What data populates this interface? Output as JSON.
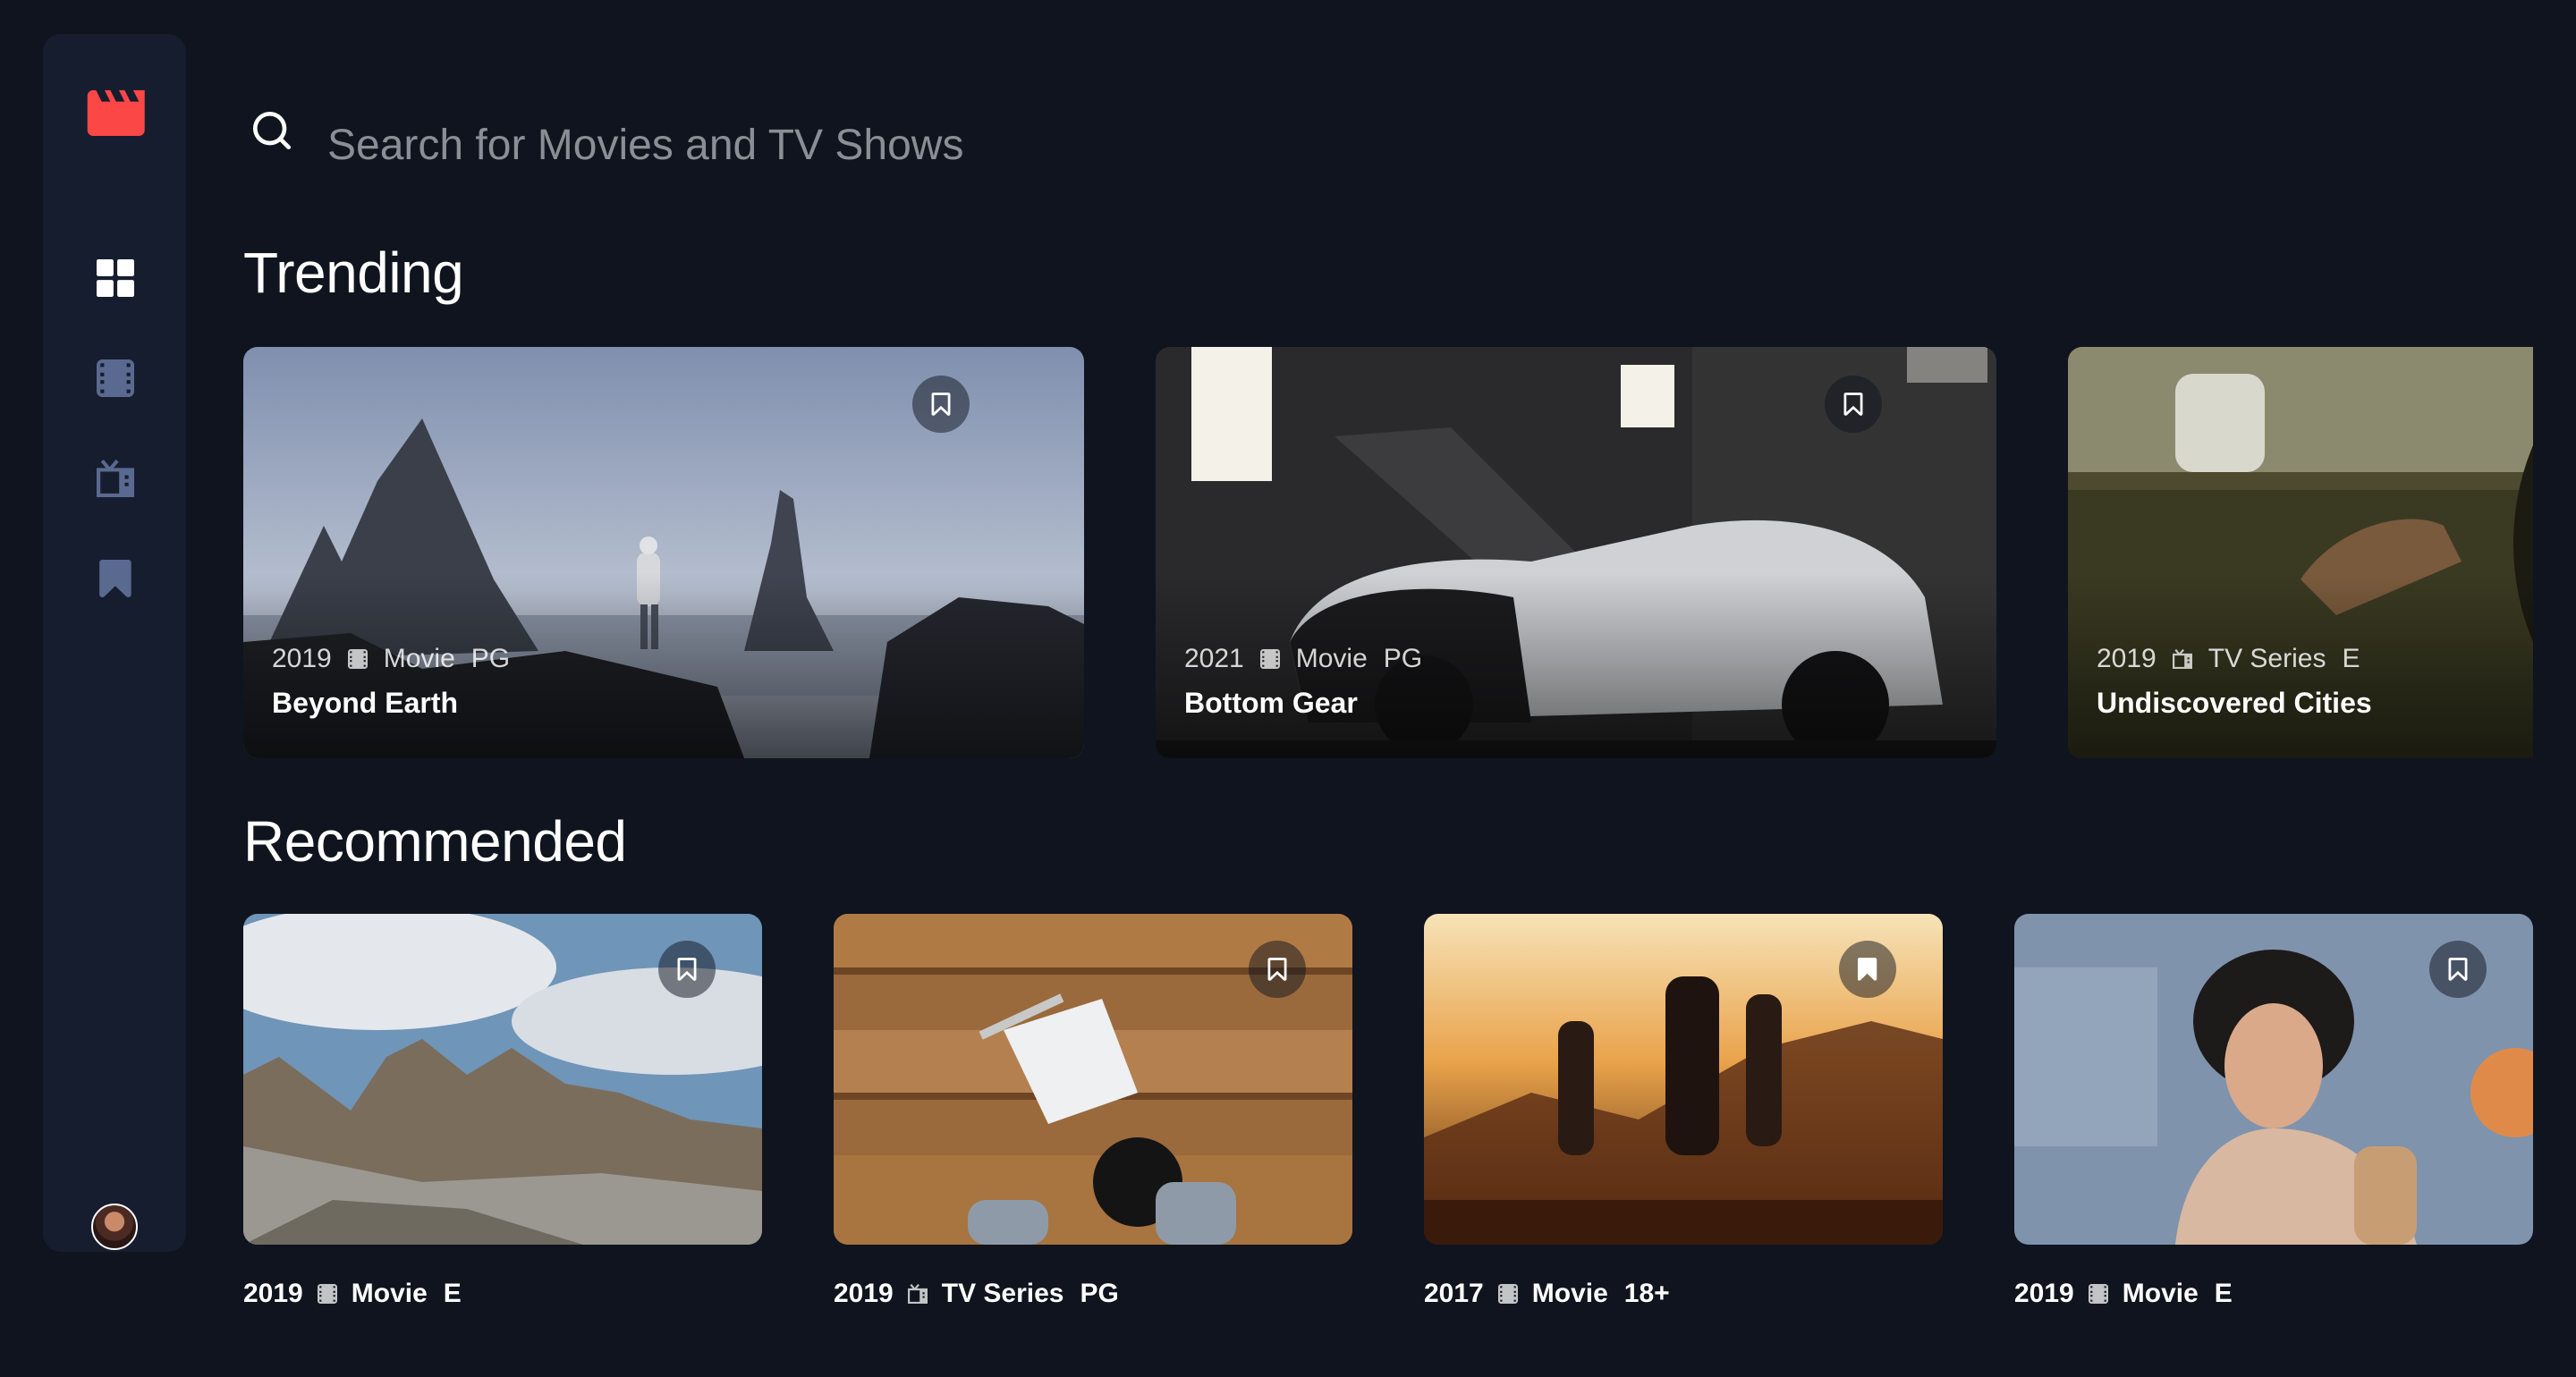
{
  "search": {
    "placeholder": "Search for Movies and TV Shows"
  },
  "sections": {
    "trending": "Trending",
    "recommended": "Recommended"
  },
  "colors": {
    "background": "#10141e",
    "sidebar": "#161d2f",
    "brand": "#fc4747",
    "nav_inactive": "#5a698f",
    "nav_active": "#ffffff"
  },
  "nav": [
    {
      "name": "home",
      "icon": "grid-icon",
      "active": true
    },
    {
      "name": "movies",
      "icon": "film-icon",
      "active": false
    },
    {
      "name": "tv-series",
      "icon": "tv-icon",
      "active": false
    },
    {
      "name": "bookmarks",
      "icon": "bookmark-icon",
      "active": false
    }
  ],
  "trending": [
    {
      "year": "2019",
      "category": "Movie",
      "icon": "film-icon",
      "rating": "PG",
      "title": "Beyond Earth"
    },
    {
      "year": "2021",
      "category": "Movie",
      "icon": "film-icon",
      "rating": "PG",
      "title": "Bottom Gear"
    },
    {
      "year": "2019",
      "category": "TV Series",
      "icon": "tv-icon",
      "rating": "E",
      "title": "Undiscovered Cities"
    }
  ],
  "recommended": [
    {
      "year": "2019",
      "category": "Movie",
      "icon": "film-icon",
      "rating": "E"
    },
    {
      "year": "2019",
      "category": "TV Series",
      "icon": "tv-icon",
      "rating": "PG"
    },
    {
      "year": "2017",
      "category": "Movie",
      "icon": "film-icon",
      "rating": "18+"
    },
    {
      "year": "2019",
      "category": "Movie",
      "icon": "film-icon",
      "rating": "E"
    }
  ]
}
